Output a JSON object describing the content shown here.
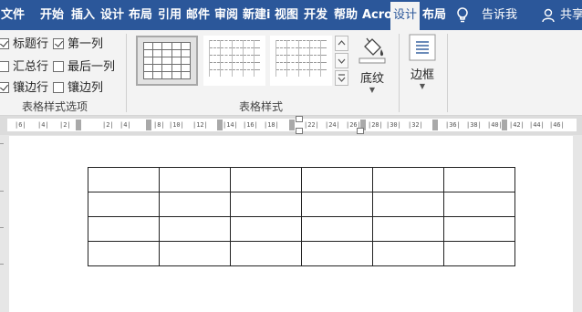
{
  "ribbon_tabs": [
    {
      "label": "文件"
    },
    {
      "label": "开始"
    },
    {
      "label": "插入"
    },
    {
      "label": "设计"
    },
    {
      "label": "布局"
    },
    {
      "label": "引用"
    },
    {
      "label": "邮件"
    },
    {
      "label": "审阅"
    },
    {
      "label": "新建i"
    },
    {
      "label": "视图"
    },
    {
      "label": "开发"
    },
    {
      "label": "帮助"
    },
    {
      "label": "Acro"
    },
    {
      "label": "设计",
      "active": true
    },
    {
      "label": "布局"
    }
  ],
  "tell_me": "告诉我",
  "share": "共享",
  "style_options": {
    "items": [
      {
        "label": "标题行",
        "checked": true
      },
      {
        "label": "第一列",
        "checked": true
      },
      {
        "label": "汇总行",
        "checked": false
      },
      {
        "label": "最后一列",
        "checked": false
      },
      {
        "label": "镶边行",
        "checked": true
      },
      {
        "label": "镶边列",
        "checked": false
      }
    ],
    "group_label": "表格样式选项"
  },
  "table_styles": {
    "group_label": "表格样式",
    "shading_label": "底纹",
    "borders_label": "边框"
  },
  "ruler": {
    "numbers": [
      "|6|",
      "|4|",
      "|2|",
      "|2|",
      "|4|",
      "|8|",
      "|10|",
      "|12|",
      "|14|",
      "|16|",
      "|18|",
      "|22|",
      "|24|",
      "|26|",
      "|28|",
      "|30|",
      "|32|",
      "|36|",
      "|38|",
      "|40|",
      "|42|",
      "|44|",
      "|46|"
    ]
  },
  "document_table": {
    "rows": 4,
    "cols": 6
  },
  "colors": {
    "accent": "#2b579a",
    "ribbon_bg": "#f3f3f3"
  }
}
